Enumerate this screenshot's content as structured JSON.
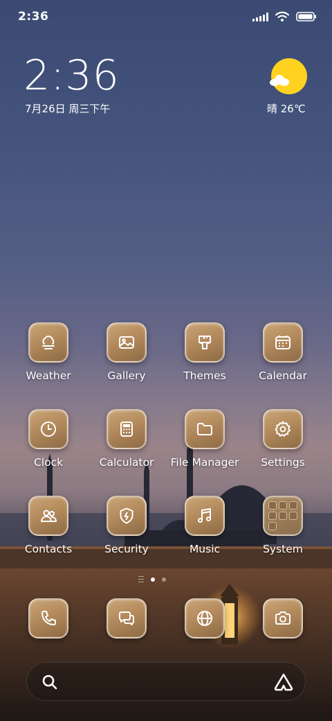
{
  "status_bar": {
    "time": "2:36"
  },
  "clock_widget": {
    "time": "2:36",
    "date": "7月26日 周三下午"
  },
  "weather_widget": {
    "condition_temp": "晴 26℃",
    "icon": "sun-cloud-icon"
  },
  "apps": [
    {
      "label": "Weather",
      "icon": "weather-cloud-icon"
    },
    {
      "label": "Gallery",
      "icon": "image-icon"
    },
    {
      "label": "Themes",
      "icon": "paintbrush-icon"
    },
    {
      "label": "Calendar",
      "icon": "calendar-icon"
    },
    {
      "label": "Clock",
      "icon": "clock-icon"
    },
    {
      "label": "Calculator",
      "icon": "calculator-icon"
    },
    {
      "label": "File Manager",
      "icon": "folder-icon"
    },
    {
      "label": "Settings",
      "icon": "gear-icon"
    },
    {
      "label": "Contacts",
      "icon": "contacts-icon"
    },
    {
      "label": "Security",
      "icon": "shield-icon"
    },
    {
      "label": "Music",
      "icon": "music-note-icon"
    },
    {
      "label": "System",
      "icon": "folder-grid-icon"
    }
  ],
  "dock": [
    {
      "icon": "phone-icon"
    },
    {
      "icon": "messages-icon"
    },
    {
      "icon": "browser-globe-icon"
    },
    {
      "icon": "camera-icon"
    }
  ],
  "pager": {
    "pages": 2,
    "active": 1
  },
  "search_bar": {
    "left_icon": "search-icon",
    "right_icon": "assistant-icon"
  },
  "colors": {
    "tile": "#b38a5c",
    "sun": "#ffd21f"
  }
}
